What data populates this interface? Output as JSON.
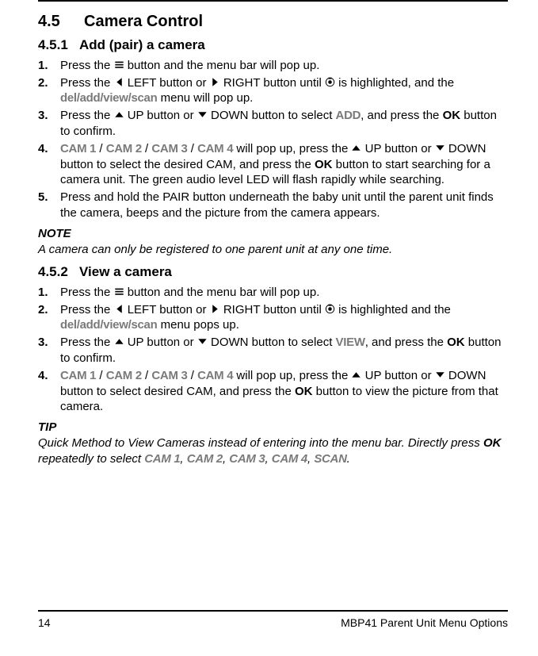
{
  "section": {
    "num": "4.5",
    "title": "Camera Control"
  },
  "sub1": {
    "num": "4.5.1",
    "title": "Add (pair) a camera",
    "steps": [
      {
        "n": "1.",
        "parts": [
          "Press the ",
          "@menu",
          " button and the menu bar will pop up."
        ]
      },
      {
        "n": "2.",
        "parts": [
          "Press the ",
          "@left",
          " LEFT button or ",
          "@right",
          " RIGHT button until ",
          "@cam",
          " is highlighted, and the ",
          "@mono:del/add/view/scan",
          " menu will pop up."
        ]
      },
      {
        "n": "3.",
        "parts": [
          "Press the ",
          "@up",
          " UP button or ",
          "@down",
          " DOWN button to select ",
          "@mono:ADD",
          ", and press the ",
          "@ok:OK",
          " button to confirm."
        ]
      },
      {
        "n": "4.",
        "parts": [
          "@mono:CAM 1",
          " / ",
          "@mono:CAM 2",
          " / ",
          "@mono:CAM 3",
          " / ",
          "@mono:CAM 4",
          " will pop up, press the ",
          "@up",
          " UP button or ",
          "@down",
          " DOWN button to select the desired CAM, and press the ",
          "@ok:OK",
          " button to start searching for a camera unit. The green audio level LED will flash rapidly while searching."
        ]
      },
      {
        "n": "5.",
        "parts": [
          "Press and hold the PAIR button underneath the baby unit until the parent unit finds the camera, beeps and the picture from the camera appears."
        ]
      }
    ],
    "note_h": "NOTE",
    "note_b": "A camera can only be registered to one parent unit at any one time."
  },
  "sub2": {
    "num": "4.5.2",
    "title": "View a camera",
    "steps": [
      {
        "n": "1.",
        "parts": [
          "Press the ",
          "@menu",
          " button and the menu bar will pop up."
        ]
      },
      {
        "n": "2.",
        "parts": [
          "Press the ",
          "@left",
          " LEFT button or ",
          "@right",
          " RIGHT button until ",
          "@cam",
          " is highlighted and the ",
          "@mono:del/add/view/scan",
          " menu pops up."
        ]
      },
      {
        "n": "3.",
        "parts": [
          "Press the ",
          "@up",
          " UP button or ",
          "@down",
          " DOWN button to select ",
          "@mono:VIEW",
          ", and press the ",
          "@ok:OK",
          " button to confirm."
        ]
      },
      {
        "n": "4.",
        "parts": [
          "@mono:CAM 1",
          " / ",
          "@mono:CAM 2",
          " / ",
          "@mono:CAM 3",
          " / ",
          "@mono:CAM 4",
          " will pop up, press the ",
          "@up",
          " UP button or ",
          "@down",
          " DOWN button to select desired CAM, and press the ",
          "@ok:OK",
          " button to view the picture from that camera."
        ]
      }
    ],
    "tip_h": "TIP",
    "tip_b_parts": [
      "Quick Method to View Cameras instead of entering into the menu bar. Directly press ",
      "@ok:OK",
      " repeatedly to select ",
      "@mono:CAM 1",
      ", ",
      "@mono:CAM 2",
      ", ",
      "@mono:CAM 3",
      ", ",
      "@mono:CAM 4",
      ", ",
      "@mono:SCAN",
      "."
    ]
  },
  "footer": {
    "page": "14",
    "label": "MBP41 Parent Unit Menu Options"
  }
}
